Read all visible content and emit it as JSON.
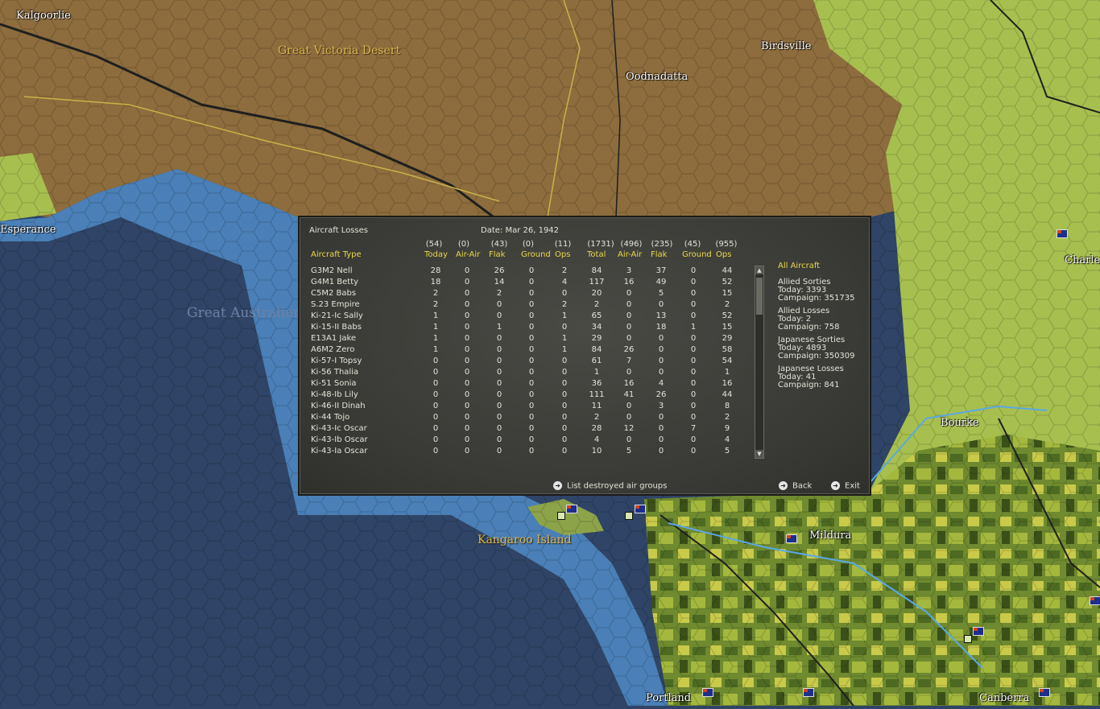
{
  "map": {
    "labels": {
      "kalgoorlie": "Kalgoorlie",
      "great_victoria_desert": "Great Victoria Desert",
      "birdsville": "Birdsville",
      "oodnadatta": "Oodnadatta",
      "esperance": "Esperance",
      "great_australian_bight": "Great Australian Bight",
      "charleville": "Charley",
      "bourke": "Bourke",
      "mildura": "Mildura",
      "kangaroo_island": "Kangaroo Island",
      "portland": "Portland",
      "canberra": "Canberra"
    },
    "colors": {
      "ocean_deep": "#2f4466",
      "ocean_shallow": "#4a86bd",
      "desert": "#8a6a3a",
      "grassland": "#a8c24e",
      "farmland": "#6e8a2e"
    }
  },
  "dialog": {
    "title": "Aircraft Losses",
    "date": "Date: Mar 26, 1942",
    "totals": {
      "today": "(54)",
      "air_air": "(0)",
      "flak": "(43)",
      "ground": "(0)",
      "ops": "(11)",
      "total": "(1731)",
      "total_air_air": "(496)",
      "total_flak": "(235)",
      "total_ground": "(45)",
      "total_ops": "(955)"
    },
    "headers": {
      "type": "Aircraft Type",
      "today": "Today",
      "air_air": "Air-Air",
      "flak": "Flak",
      "ground": "Ground",
      "ops": "Ops",
      "total": "Total",
      "total_air_air": "Air-Air",
      "total_flak": "Flak",
      "total_ground": "Ground",
      "total_ops": "Ops"
    },
    "rows": [
      {
        "name": "G3M2 Nell",
        "v": [
          "28",
          "0",
          "26",
          "0",
          "2",
          "84",
          "3",
          "37",
          "0",
          "44"
        ]
      },
      {
        "name": "G4M1 Betty",
        "v": [
          "18",
          "0",
          "14",
          "0",
          "4",
          "117",
          "16",
          "49",
          "0",
          "52"
        ]
      },
      {
        "name": "C5M2 Babs",
        "v": [
          "2",
          "0",
          "2",
          "0",
          "0",
          "20",
          "0",
          "5",
          "0",
          "15"
        ]
      },
      {
        "name": "S.23 Empire",
        "v": [
          "2",
          "0",
          "0",
          "0",
          "2",
          "2",
          "0",
          "0",
          "0",
          "2"
        ]
      },
      {
        "name": "Ki-21-Ic Sally",
        "v": [
          "1",
          "0",
          "0",
          "0",
          "1",
          "65",
          "0",
          "13",
          "0",
          "52"
        ]
      },
      {
        "name": "Ki-15-II Babs",
        "v": [
          "1",
          "0",
          "1",
          "0",
          "0",
          "34",
          "0",
          "18",
          "1",
          "15"
        ]
      },
      {
        "name": "E13A1 Jake",
        "v": [
          "1",
          "0",
          "0",
          "0",
          "1",
          "29",
          "0",
          "0",
          "0",
          "29"
        ]
      },
      {
        "name": "A6M2 Zero",
        "v": [
          "1",
          "0",
          "0",
          "0",
          "1",
          "84",
          "26",
          "0",
          "0",
          "58"
        ]
      },
      {
        "name": "Ki-57-I Topsy",
        "v": [
          "0",
          "0",
          "0",
          "0",
          "0",
          "61",
          "7",
          "0",
          "0",
          "54"
        ]
      },
      {
        "name": "Ki-56 Thalia",
        "v": [
          "0",
          "0",
          "0",
          "0",
          "0",
          "1",
          "0",
          "0",
          "0",
          "1"
        ]
      },
      {
        "name": "Ki-51 Sonia",
        "v": [
          "0",
          "0",
          "0",
          "0",
          "0",
          "36",
          "16",
          "4",
          "0",
          "16"
        ]
      },
      {
        "name": "Ki-48-Ib Lily",
        "v": [
          "0",
          "0",
          "0",
          "0",
          "0",
          "111",
          "41",
          "26",
          "0",
          "44"
        ]
      },
      {
        "name": "Ki-46-II Dinah",
        "v": [
          "0",
          "0",
          "0",
          "0",
          "0",
          "11",
          "0",
          "3",
          "0",
          "8"
        ]
      },
      {
        "name": "Ki-44 Tojo",
        "v": [
          "0",
          "0",
          "0",
          "0",
          "0",
          "2",
          "0",
          "0",
          "0",
          "2"
        ]
      },
      {
        "name": "Ki-43-Ic Oscar",
        "v": [
          "0",
          "0",
          "0",
          "0",
          "0",
          "28",
          "12",
          "0",
          "7",
          "9"
        ]
      },
      {
        "name": "Ki-43-Ib Oscar",
        "v": [
          "0",
          "0",
          "0",
          "0",
          "0",
          "4",
          "0",
          "0",
          "0",
          "4"
        ]
      },
      {
        "name": "Ki-43-Ia Oscar",
        "v": [
          "0",
          "0",
          "0",
          "0",
          "0",
          "10",
          "5",
          "0",
          "0",
          "5"
        ]
      }
    ],
    "sidebar": {
      "all_aircraft": "All Aircraft",
      "allied_sorties": {
        "title": "Allied Sorties",
        "today": "Today:   3393",
        "campaign": "Campaign: 351735"
      },
      "allied_losses": {
        "title": "Allied Losses",
        "today": "Today:   2",
        "campaign": "Campaign: 758"
      },
      "japanese_sorties": {
        "title": "Japanese Sorties",
        "today": "Today:   4893",
        "campaign": "Campaign: 350309"
      },
      "japanese_losses": {
        "title": "Japanese Losses",
        "today": "Today:   41",
        "campaign": "Campaign: 841"
      }
    },
    "buttons": {
      "list_destroyed": "List destroyed air groups",
      "back": "Back",
      "exit": "Exit"
    },
    "colors": {
      "accent": "#e9d94a",
      "text": "#e4e4da",
      "panel": "#3b3b37"
    }
  }
}
